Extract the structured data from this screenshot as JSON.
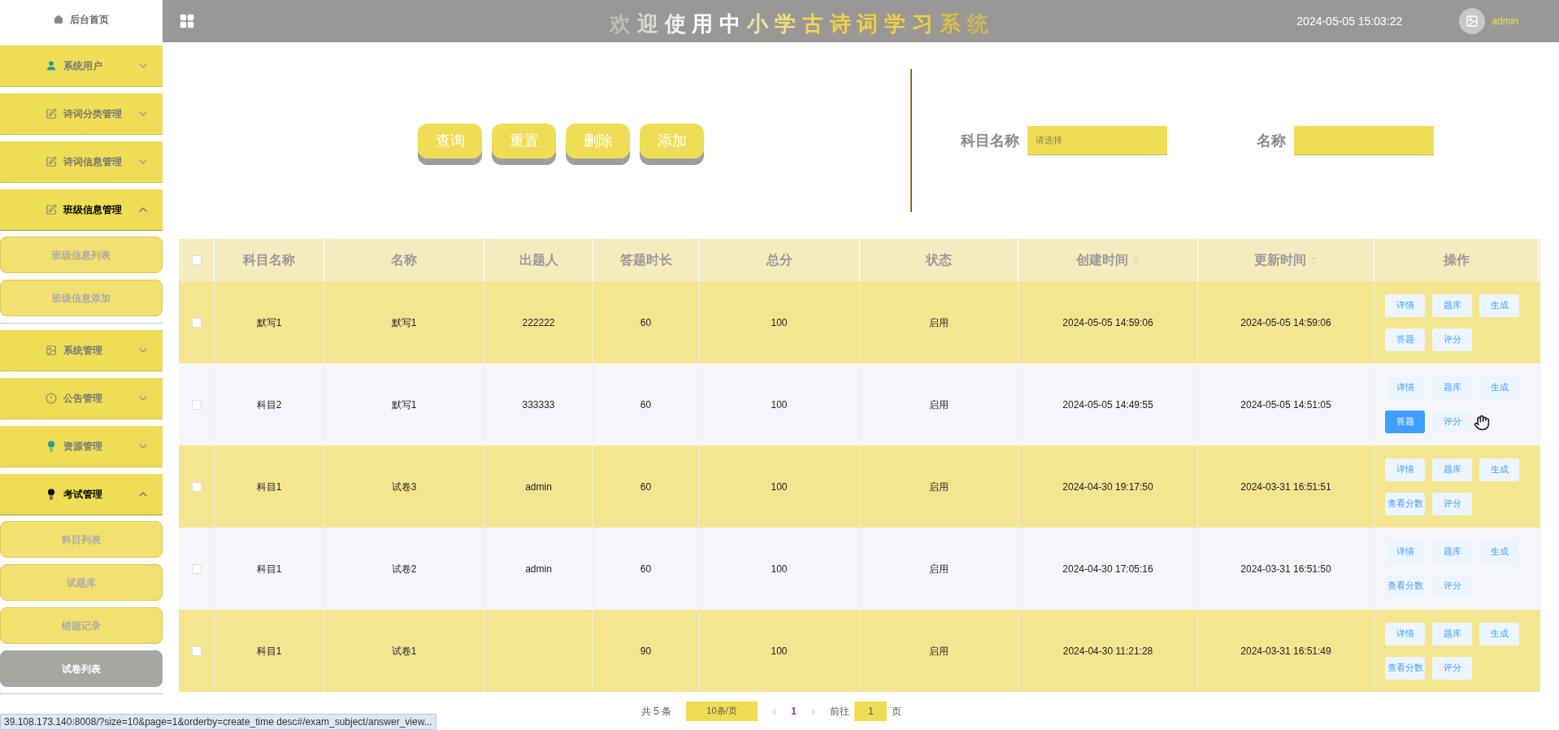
{
  "sidebar": {
    "home": {
      "label": "后台首页"
    },
    "groups": [
      {
        "label": "系统用户",
        "kind": "user",
        "expanded": false
      },
      {
        "label": "诗词分类管理",
        "kind": "note",
        "expanded": false
      },
      {
        "label": "诗词信息管理",
        "kind": "note",
        "expanded": false
      },
      {
        "label": "班级信息管理",
        "kind": "note",
        "expanded": true,
        "children": [
          {
            "label": "班级信息列表",
            "selected": false
          },
          {
            "label": "班级信息添加",
            "selected": false
          }
        ]
      },
      {
        "label": "系统管理",
        "kind": "image",
        "expanded": false
      },
      {
        "label": "公告管理",
        "kind": "alert",
        "expanded": false
      },
      {
        "label": "资源管理",
        "kind": "bulb",
        "expanded": false
      },
      {
        "label": "考试管理",
        "kind": "bulb-dark",
        "expanded": true,
        "children": [
          {
            "label": "科目列表",
            "selected": false
          },
          {
            "label": "试题库",
            "selected": false
          },
          {
            "label": "错题记录",
            "selected": false
          },
          {
            "label": "试卷列表",
            "selected": true
          }
        ]
      }
    ]
  },
  "header": {
    "title_chars": [
      {
        "char": "欢",
        "color": "#b8c0b8"
      },
      {
        "char": "迎",
        "color": "#d8d8d0"
      },
      {
        "char": "使",
        "color": "#f2f2f2"
      },
      {
        "char": "用",
        "color": "#ffffff"
      },
      {
        "char": "中",
        "color": "#ffffff"
      },
      {
        "char": "小",
        "color": "#ece6a0"
      },
      {
        "char": "学",
        "color": "#f0e070"
      },
      {
        "char": "古",
        "color": "#f2d850"
      },
      {
        "char": "诗",
        "color": "#f2d040"
      },
      {
        "char": "词",
        "color": "#f2d040"
      },
      {
        "char": "学",
        "color": "#f2d040"
      },
      {
        "char": "习",
        "color": "#f0d040"
      },
      {
        "char": "系",
        "color": "#d8c040"
      },
      {
        "char": "统",
        "color": "#c8b860"
      }
    ],
    "datetime": "2024-05-05 15:03:22",
    "user": "admin"
  },
  "toolbar": {
    "buttons": [
      "查询",
      "重置",
      "删除",
      "添加"
    ]
  },
  "search": {
    "fields": [
      {
        "kind": "select",
        "label": "科目名称",
        "placeholder": "请选择"
      },
      {
        "kind": "input",
        "label": "名称"
      }
    ]
  },
  "table": {
    "select_all_checked": false,
    "columns": [
      {
        "label": "科目名称",
        "sortable": false
      },
      {
        "label": "名称",
        "sortable": false
      },
      {
        "label": "出题人",
        "sortable": false
      },
      {
        "label": "答题时长",
        "sortable": false
      },
      {
        "label": "总分",
        "sortable": false
      },
      {
        "label": "状态",
        "sortable": false
      },
      {
        "label": "创建时间",
        "sortable": true
      },
      {
        "label": "更新时间",
        "sortable": true
      },
      {
        "label": "操作",
        "sortable": false
      }
    ],
    "rows": [
      {
        "cells": [
          "默写1",
          "默写1",
          "222222",
          "60",
          "100",
          "启用",
          "2024-05-05 14:59:06",
          "2024-05-05 14:59:06"
        ],
        "checked": false,
        "actions": [
          {
            "label": "详情",
            "hover": false
          },
          {
            "label": "题库",
            "hover": false
          },
          {
            "label": "生成",
            "hover": false
          },
          {
            "label": "答题",
            "hover": false
          },
          {
            "label": "评分",
            "hover": false
          }
        ]
      },
      {
        "cells": [
          "科目2",
          "默写1",
          "333333",
          "60",
          "100",
          "启用",
          "2024-05-05 14:49:55",
          "2024-05-05 14:51:05"
        ],
        "checked": false,
        "actions": [
          {
            "label": "详情",
            "hover": false
          },
          {
            "label": "题库",
            "hover": false
          },
          {
            "label": "生成",
            "hover": false
          },
          {
            "label": "答题",
            "hover": true
          },
          {
            "label": "评分",
            "hover": false
          }
        ]
      },
      {
        "cells": [
          "科目1",
          "试卷3",
          "admin",
          "60",
          "100",
          "启用",
          "2024-04-30 19:17:50",
          "2024-03-31 16:51:51"
        ],
        "checked": false,
        "actions": [
          {
            "label": "详情",
            "hover": false
          },
          {
            "label": "题库",
            "hover": false
          },
          {
            "label": "生成",
            "hover": false
          },
          {
            "label": "查看分数",
            "hover": false
          },
          {
            "label": "评分",
            "hover": false
          }
        ]
      },
      {
        "cells": [
          "科目1",
          "试卷2",
          "admin",
          "60",
          "100",
          "启用",
          "2024-04-30 17:05:16",
          "2024-03-31 16:51:50"
        ],
        "checked": false,
        "actions": [
          {
            "label": "详情",
            "hover": false
          },
          {
            "label": "题库",
            "hover": false
          },
          {
            "label": "生成",
            "hover": false
          },
          {
            "label": "查看分数",
            "hover": false
          },
          {
            "label": "评分",
            "hover": false
          }
        ]
      },
      {
        "cells": [
          "科目1",
          "试卷1",
          "",
          "90",
          "100",
          "启用",
          "2024-04-30 11:21:28",
          "2024-03-31 16:51:49"
        ],
        "checked": false,
        "actions": [
          {
            "label": "详情",
            "hover": false
          },
          {
            "label": "题库",
            "hover": false
          },
          {
            "label": "生成",
            "hover": false
          },
          {
            "label": "查看分数",
            "hover": false
          },
          {
            "label": "评分",
            "hover": false
          }
        ]
      }
    ]
  },
  "pagination": {
    "total": "共 5 条",
    "page_size": "10条/页",
    "prev": "‹",
    "pages": [
      {
        "label": "1",
        "selected": true
      }
    ],
    "next": "›",
    "goto_label": "前往",
    "goto_value": "1",
    "goto_suffix": "页"
  },
  "status_bar": {
    "url": "39.108.173.140:8008/?size=10&page=1&orderby=create_time desc#/exam_subject/answer_view..."
  }
}
